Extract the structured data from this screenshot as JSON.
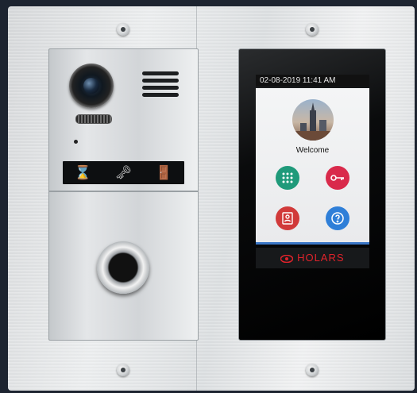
{
  "door_station": {
    "icons": [
      "hourglass-icon",
      "key-icon",
      "door-icon"
    ],
    "glyphs": [
      "⌛",
      "🗝",
      "🚪"
    ]
  },
  "monitor": {
    "datetime": "02-08-2019  11:41 AM",
    "welcome": "Welcome",
    "brand": "HOLARS",
    "apps": [
      {
        "icon": "keypad-icon",
        "color": "#1f9a7a"
      },
      {
        "icon": "key-icon",
        "color": "#d92a4b"
      },
      {
        "icon": "contacts-icon",
        "color": "#d13a3a"
      },
      {
        "icon": "help-icon",
        "color": "#2f7fd8"
      }
    ]
  },
  "colors": {
    "brand_red": "#e0232b",
    "frame": "#1d2430"
  }
}
